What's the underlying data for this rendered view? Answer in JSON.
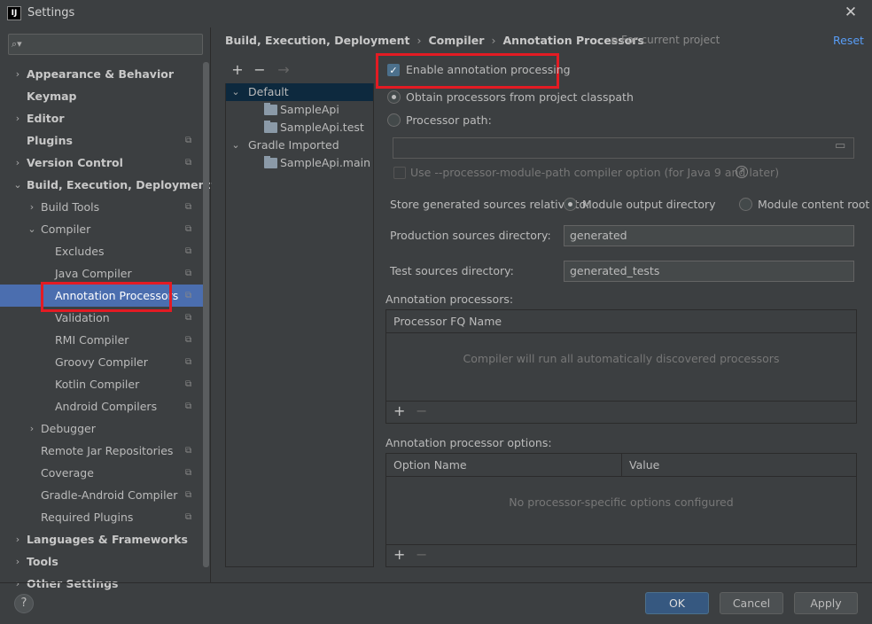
{
  "window": {
    "title": "Settings",
    "app_icon": "IJ"
  },
  "search": {
    "placeholder": ""
  },
  "sidebar": {
    "items": [
      {
        "label": "Appearance & Behavior",
        "level": 0,
        "arrow": "›",
        "bold": true
      },
      {
        "label": "Keymap",
        "level": 0,
        "bold": true
      },
      {
        "label": "Editor",
        "level": 0,
        "arrow": "›",
        "bold": true
      },
      {
        "label": "Plugins",
        "level": 0,
        "bold": true,
        "project": true
      },
      {
        "label": "Version Control",
        "level": 0,
        "arrow": "›",
        "bold": true,
        "project": true
      },
      {
        "label": "Build, Execution, Deployment",
        "level": 0,
        "arrow": "⌄",
        "bold": true
      },
      {
        "label": "Build Tools",
        "level": 1,
        "arrow": "›",
        "project": true
      },
      {
        "label": "Compiler",
        "level": 1,
        "arrow": "⌄",
        "project": true
      },
      {
        "label": "Excludes",
        "level": 2,
        "project": true
      },
      {
        "label": "Java Compiler",
        "level": 2,
        "project": true
      },
      {
        "label": "Annotation Processors",
        "level": 2,
        "project": true,
        "selected": true
      },
      {
        "label": "Validation",
        "level": 2,
        "project": true
      },
      {
        "label": "RMI Compiler",
        "level": 2,
        "project": true
      },
      {
        "label": "Groovy Compiler",
        "level": 2,
        "project": true
      },
      {
        "label": "Kotlin Compiler",
        "level": 2,
        "project": true
      },
      {
        "label": "Android Compilers",
        "level": 2,
        "project": true
      },
      {
        "label": "Debugger",
        "level": 1,
        "arrow": "›"
      },
      {
        "label": "Remote Jar Repositories",
        "level": 1,
        "project": true
      },
      {
        "label": "Coverage",
        "level": 1,
        "project": true
      },
      {
        "label": "Gradle-Android Compiler",
        "level": 1,
        "project": true
      },
      {
        "label": "Required Plugins",
        "level": 1,
        "project": true
      },
      {
        "label": "Languages & Frameworks",
        "level": 0,
        "arrow": "›",
        "bold": true
      },
      {
        "label": "Tools",
        "level": 0,
        "arrow": "›",
        "bold": true
      },
      {
        "label": "Other Settings",
        "level": 0,
        "arrow": "›",
        "bold": true
      }
    ]
  },
  "breadcrumb": {
    "parts": [
      "Build, Execution, Deployment",
      "Compiler",
      "Annotation Processors"
    ],
    "separator": "›",
    "for_project": "For current project",
    "reset": "Reset"
  },
  "profiles": {
    "toolbar": {
      "add": "+",
      "remove": "−",
      "move": "→"
    },
    "rows": [
      {
        "label": "Default",
        "type": "group",
        "arrow": "⌄",
        "selected": true
      },
      {
        "label": "SampleApi",
        "type": "module"
      },
      {
        "label": "SampleApi.test",
        "type": "module"
      },
      {
        "label": "Gradle Imported",
        "type": "group",
        "arrow": "⌄"
      },
      {
        "label": "SampleApi.main",
        "type": "module"
      }
    ]
  },
  "settings": {
    "enable_label": "Enable annotation processing",
    "enable_checked": true,
    "obtain_label": "Obtain processors from project classpath",
    "path_label": "Processor path:",
    "processor_path_value": "",
    "module_path_label": "Use --processor-module-path compiler option (for Java 9 and later)",
    "store_label": "Store generated sources relative to:",
    "module_output_label": "Module output directory",
    "module_content_label": "Module content root",
    "prod_dir_label": "Production sources directory:",
    "prod_dir_value": "generated",
    "test_dir_label": "Test sources directory:",
    "test_dir_value": "generated_tests"
  },
  "processors_table": {
    "title": "Annotation processors:",
    "column": "Processor FQ Name",
    "empty": "Compiler will run all automatically discovered processors",
    "add": "+",
    "remove": "−"
  },
  "options_table": {
    "title": "Annotation processor options:",
    "columns": [
      "Option Name",
      "Value"
    ],
    "empty": "No processor-specific options configured",
    "add": "+",
    "remove": "−"
  },
  "footer": {
    "help": "?",
    "ok": "OK",
    "cancel": "Cancel",
    "apply": "Apply"
  },
  "colors": {
    "accent": "#4b6eaf",
    "highlight": "#e31b23",
    "link": "#589df6",
    "background": "#3c3f41"
  }
}
